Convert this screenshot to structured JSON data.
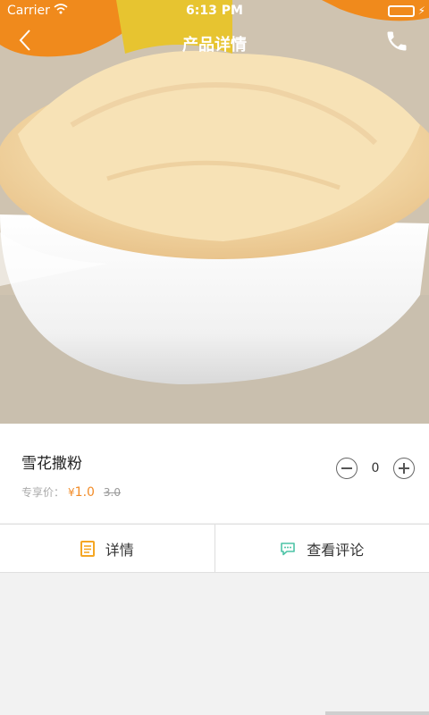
{
  "status_bar": {
    "carrier": "Carrier",
    "time": "6:13 PM"
  },
  "nav": {
    "title": "产品详情",
    "back_icon": "chevron-left-icon",
    "call_icon": "phone-icon"
  },
  "product": {
    "name": "雪花撒粉",
    "price_label": "专享价：",
    "currency": "¥",
    "price": "1.0",
    "original_price": "3.0",
    "quantity": "0"
  },
  "tabs": [
    {
      "label": "详情",
      "icon": "document-icon",
      "color": "#f5a623"
    },
    {
      "label": "查看评论",
      "icon": "comment-bubble-icon",
      "color": "#4cc3a6"
    }
  ],
  "colors": {
    "accent": "#f28c28",
    "battery": "#4cd964"
  }
}
